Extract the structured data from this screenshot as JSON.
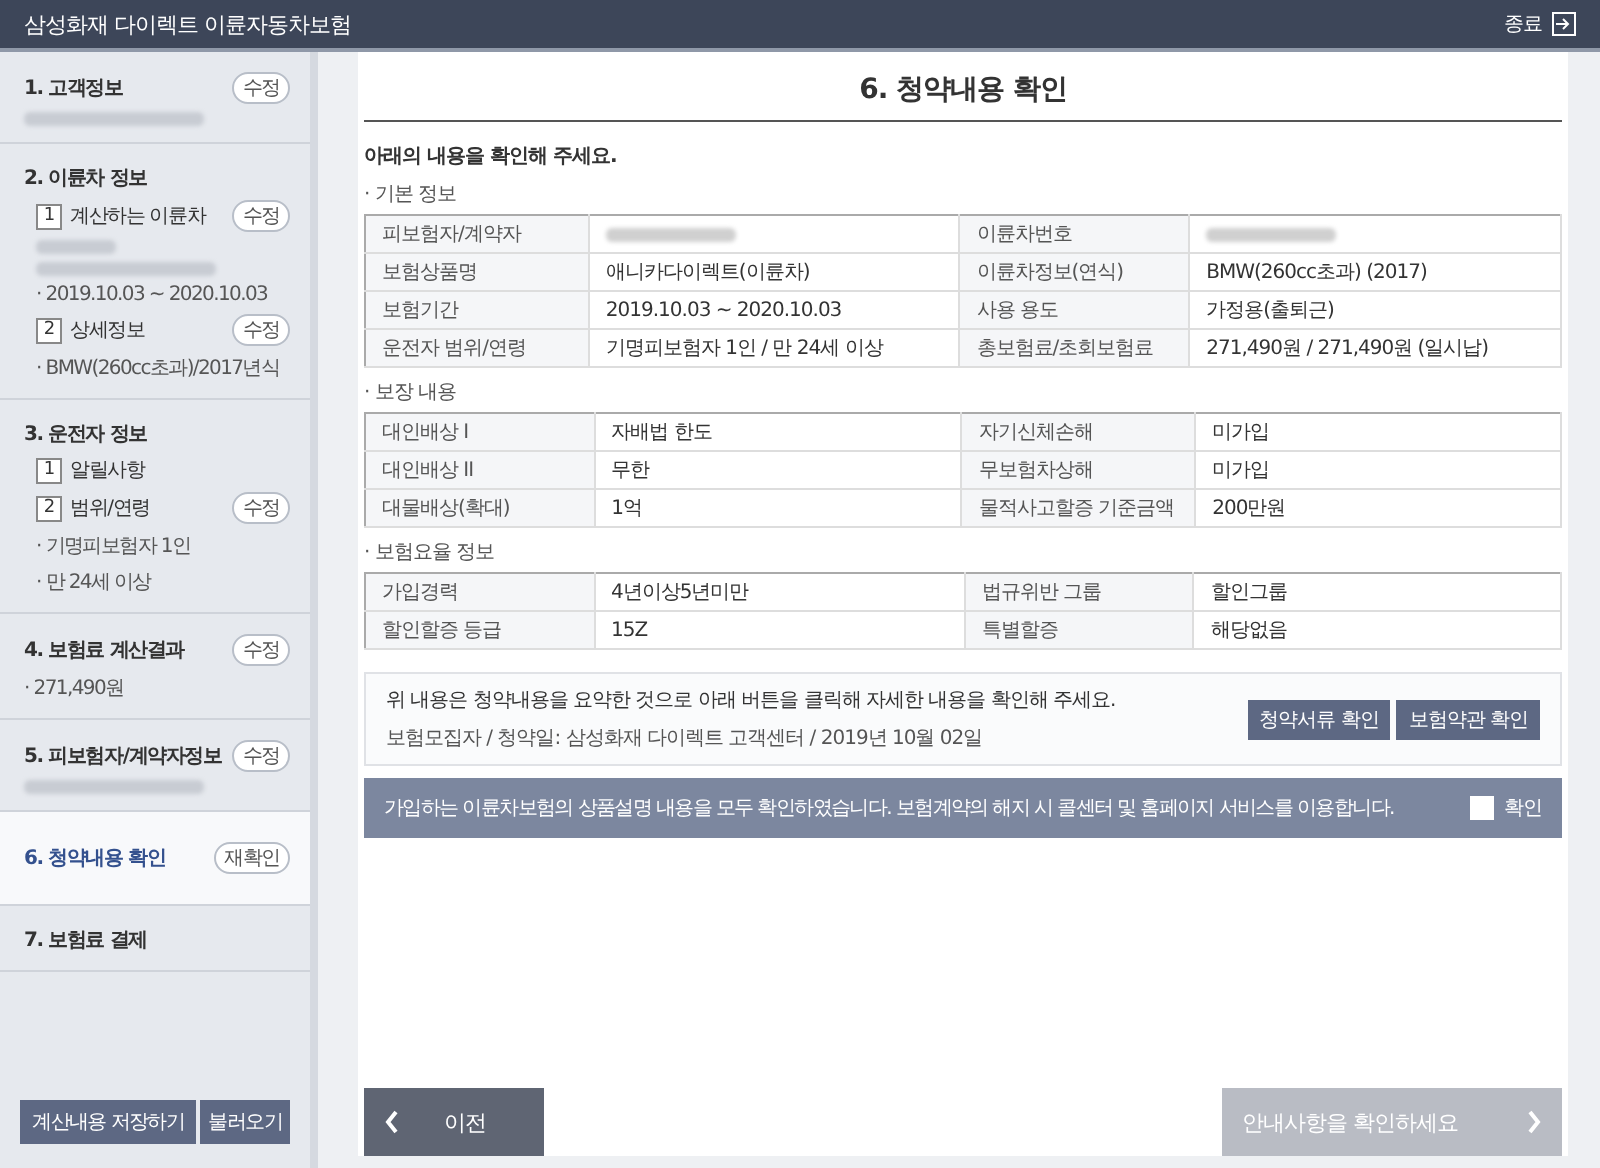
{
  "header": {
    "title": "삼성화재 다이렉트 이륜자동차보험",
    "exit_label": "종료"
  },
  "sidebar": {
    "steps": [
      {
        "title": "1. 고객정보",
        "action": "수정",
        "selected": false,
        "masked": true
      },
      {
        "title": "2. 이륜차 정보",
        "selected": false,
        "masked": false,
        "substeps": [
          {
            "num": "1",
            "title": "계산하는 이륜차",
            "action": "수정",
            "masked": true,
            "lines": [
              "· 2019.10.03 ~ 2020.10.03"
            ]
          },
          {
            "num": "2",
            "title": "상세정보",
            "action": "수정",
            "masked": false,
            "lines": [
              "· BMW(260cc초과)/2017년식"
            ]
          }
        ]
      },
      {
        "title": "3. 운전자 정보",
        "selected": false,
        "masked": false,
        "substeps": [
          {
            "num": "1",
            "title": "알릴사항",
            "masked": false
          },
          {
            "num": "2",
            "title": "범위/연령",
            "action": "수정",
            "masked": false,
            "lines": [
              "· 기명피보험자 1인",
              "· 만 24세 이상"
            ]
          }
        ]
      },
      {
        "title": "4. 보험료 계산결과",
        "action": "수정",
        "selected": false,
        "masked": false,
        "lines": [
          "· 271,490원"
        ]
      },
      {
        "title": "5. 피보험자/계약자정보",
        "action": "수정",
        "selected": false,
        "masked": true
      },
      {
        "title": "6. 청약내용 확인",
        "action": "재확인",
        "selected": true,
        "masked": false
      },
      {
        "title": "7. 보험료 결제",
        "selected": false,
        "masked": false
      }
    ],
    "buttons": [
      "계산내용 저장하기",
      "불러오기"
    ]
  },
  "main": {
    "title": "6. 청약내용 확인",
    "intro": "아래의 내용을 확인해 주세요.",
    "sections": [
      {
        "heading": "· 기본 정보",
        "rows": [
          [
            {
              "label": "피보험자/계약자",
              "masked": true
            },
            {
              "label": "이륜차번호",
              "masked": true
            }
          ],
          [
            {
              "label": "보험상품명",
              "value": "애니카다이렉트(이륜차)"
            },
            {
              "label": "이륜차정보(연식)",
              "value": "BMW(260cc초과) (2017)"
            }
          ],
          [
            {
              "label": "보험기간",
              "value": "2019.10.03 ~ 2020.10.03"
            },
            {
              "label": "사용 용도",
              "value": "가정용(출퇴근)"
            }
          ],
          [
            {
              "label": "운전자 범위/연령",
              "value": "기명피보험자 1인 / 만 24세 이상"
            },
            {
              "label": "총보험료/초회보험료",
              "value": "271,490원 / 271,490원 (일시납)"
            }
          ]
        ]
      },
      {
        "heading": "· 보장 내용",
        "rows": [
          [
            {
              "label": "대인배상 I",
              "value": "자배법 한도"
            },
            {
              "label": "자기신체손해",
              "value": "미가입"
            }
          ],
          [
            {
              "label": "대인배상 II",
              "value": "무한"
            },
            {
              "label": "무보험차상해",
              "value": "미가입"
            }
          ],
          [
            {
              "label": "대물배상(확대)",
              "value": "1억"
            },
            {
              "label": "물적사고할증 기준금액",
              "value": "200만원"
            }
          ]
        ]
      },
      {
        "heading": "· 보험요율 정보",
        "rows": [
          [
            {
              "label": "가입경력",
              "value": "4년이상5년미만"
            },
            {
              "label": "법규위반 그룹",
              "value": "할인그룹"
            }
          ],
          [
            {
              "label": "할인할증 등급",
              "value": "15Z"
            },
            {
              "label": "특별할증",
              "value": "해당없음"
            }
          ]
        ]
      }
    ],
    "notice": {
      "text": "위 내용은 청약내용을 요약한 것으로 아래 버튼을 클릭해 자세한 내용을 확인해 주세요.",
      "sub": "보험모집자 / 청약일: 삼성화재 다이렉트 고객센터 / 2019년 10월 02일",
      "buttons": [
        "청약서류 확인",
        "보험약관 확인"
      ]
    },
    "agree": {
      "text": "가입하는 이륜차보험의 상품설명 내용을 모두 확인하였습니다. 보험계약의 해지 시 콜센터 및 홈페이지 서비스를 이용합니다.",
      "label": "확인",
      "checked": false
    },
    "prev": {
      "label": "이전"
    },
    "next": {
      "label": "안내사항을 확인하세요",
      "disabled": true
    }
  }
}
